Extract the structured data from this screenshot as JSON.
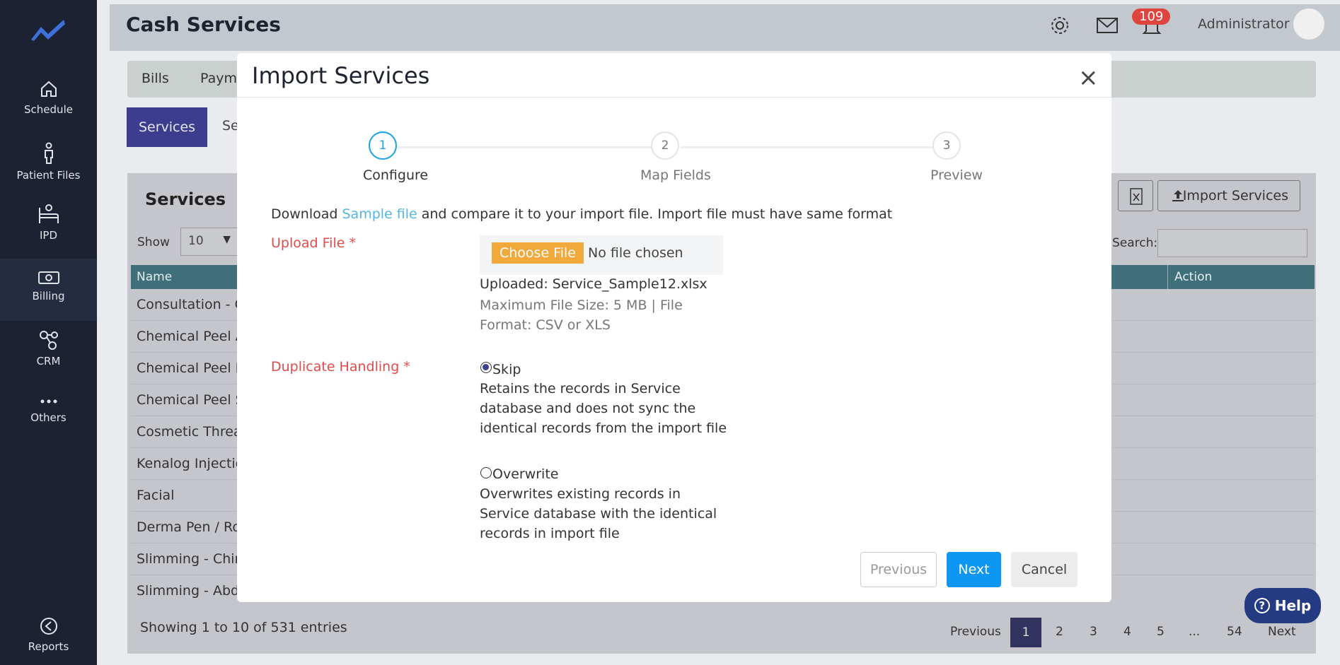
{
  "app": {
    "title": "Cash Services",
    "notification_count": "109",
    "user": "Administrator"
  },
  "sidebar": {
    "items": [
      {
        "label": "Schedule",
        "icon": "home-icon"
      },
      {
        "label": "Patient Files",
        "icon": "person-icon"
      },
      {
        "label": "IPD",
        "icon": "bed-icon"
      },
      {
        "label": "Billing",
        "icon": "money-icon"
      },
      {
        "label": "CRM",
        "icon": "crm-icon"
      },
      {
        "label": "Others",
        "icon": "more-icon"
      },
      {
        "label": "Reports",
        "icon": "reports-icon"
      }
    ],
    "active": "Billing"
  },
  "background": {
    "tabs": [
      "Bills",
      "Paym"
    ],
    "subtabs": [
      "Services",
      "Se"
    ],
    "section_title": "Services",
    "show_label": "Show",
    "show_value": "10",
    "import_button": "Import Services",
    "search_label": "Search:",
    "columns": [
      "Name",
      "Action"
    ],
    "rows": [
      "Consultation - C",
      "Chemical Peel A",
      "Chemical Peel Fa",
      "Chemical Peel S",
      "Cosmetic Threac",
      "Kenalog Injection",
      "Facial",
      "Derma Pen / Rol",
      "Slimming - Chin",
      "Slimming - Abdo"
    ],
    "showing": "Showing 1 to 10 of 531 entries",
    "pagination": [
      "Previous",
      "1",
      "2",
      "3",
      "4",
      "5",
      "...",
      "54",
      "Next"
    ],
    "help": "Help"
  },
  "modal": {
    "title": "Import Services",
    "steps": [
      {
        "number": "1",
        "label": "Configure"
      },
      {
        "number": "2",
        "label": "Map Fields"
      },
      {
        "number": "3",
        "label": "Preview"
      }
    ],
    "active_step": 1,
    "download_prefix": "Download ",
    "download_link": "Sample file",
    "download_suffix": " and compare it to your import file. Import file must have same format",
    "upload_label": "Upload File *",
    "choose_file": "Choose File",
    "no_file": "No file chosen",
    "uploaded": "Uploaded: Service_Sample12.xlsx",
    "helper": "Maximum File Size: 5 MB | File Format: CSV or XLS",
    "duplicate_label": "Duplicate Handling *",
    "options": [
      {
        "label": "Skip",
        "checked": true,
        "description": "Retains the records in Service database and does not sync the identical records from the import file"
      },
      {
        "label": "Overwrite",
        "checked": false,
        "description": "Overwrites existing records in Service database with the identical records in import file"
      }
    ],
    "buttons": {
      "previous": "Previous",
      "next": "Next",
      "cancel": "Cancel"
    }
  },
  "colors": {
    "primary": "#0d96f2",
    "accent": "#17a2e6",
    "required": "#e04b4b",
    "sidebar": "#1d2233"
  }
}
